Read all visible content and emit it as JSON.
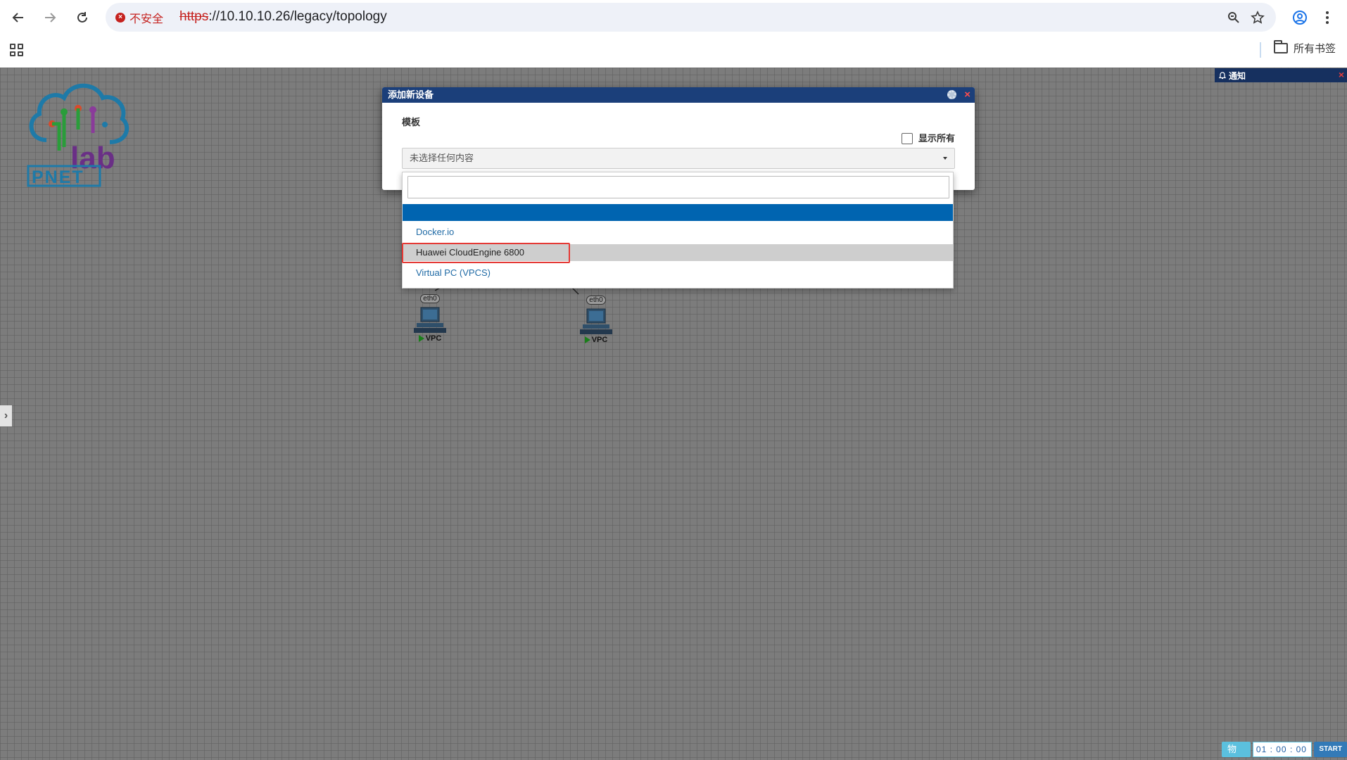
{
  "browser": {
    "security_label": "不安全",
    "url_scheme": "https",
    "url_rest": "://10.10.10.26/legacy/topology",
    "bookmarks_label": "所有书签"
  },
  "notification": {
    "title": "通知"
  },
  "logo": {
    "text": "PNET",
    "lab_text": "lab"
  },
  "nodes": [
    {
      "port": "eth0",
      "name": "VPC"
    },
    {
      "port": "eth0",
      "name": "VPC"
    }
  ],
  "dialog": {
    "title": "添加新设备",
    "template_label": "模板",
    "show_all_label": "显示所有",
    "select_placeholder": "未选择任何内容",
    "options": [
      "Docker.io",
      "Huawei CloudEngine 6800",
      "Virtual PC (VPCS)"
    ]
  },
  "toolbar": {
    "phys_label": "物理",
    "timer": "01 : 00 : 00",
    "start_label": "START"
  },
  "colors": {
    "dialog_header": "#1b3f7a",
    "dropdown_highlight": "#0064b0",
    "canvas": "#7c7c7c",
    "annotation_box": "#e53935"
  }
}
